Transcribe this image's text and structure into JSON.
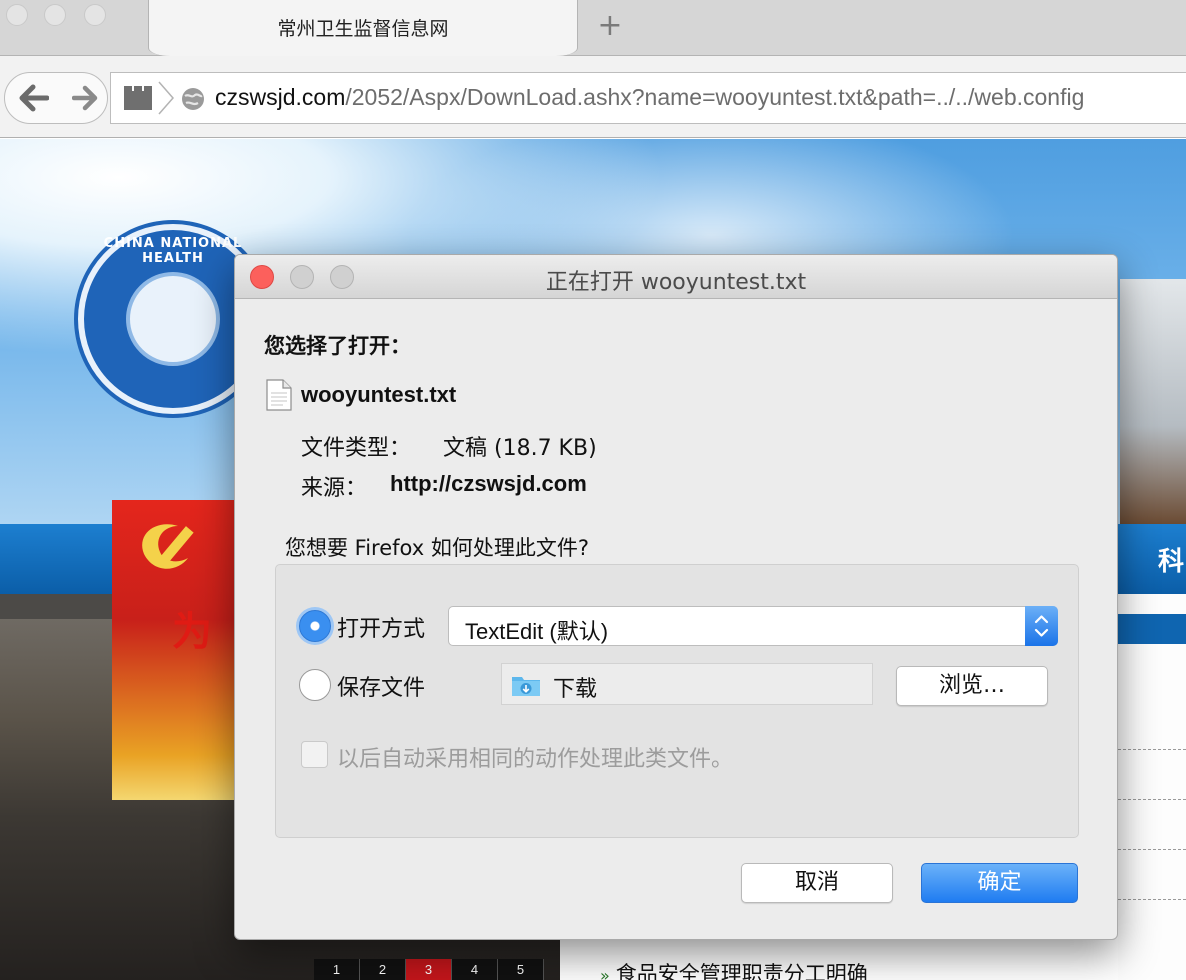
{
  "browser": {
    "tab_title": "常州卫生监督信息网",
    "new_tab_symbol": "+",
    "url_host": "czswsjd.com",
    "url_path": "/2052/Aspx/DownLoad.ashx?name=wooyuntest.txt&path=../../web.config"
  },
  "page": {
    "emblem_text": "CHINA NATIONAL HEALTH",
    "poster_char": "为",
    "nav_label": "科",
    "pager": [
      "1",
      "2",
      "3",
      "4",
      "5"
    ],
    "pager_active": "3",
    "headline": "食品安全管理职责分工明确"
  },
  "dialog": {
    "title": "正在打开 wooyuntest.txt",
    "heading": "您选择了打开：",
    "file_name": "wooyuntest.txt",
    "file_type_label": "文件类型：",
    "file_type_value": "文稿 (18.7 KB)",
    "source_label": "来源：",
    "source_value": "http://czswsjd.com",
    "question": "您想要 Firefox 如何处理此文件?",
    "open_with_label": "打开方式",
    "open_with_app": "TextEdit (默认)",
    "save_file_label": "保存文件",
    "download_folder": "下载",
    "browse_label": "浏览…",
    "auto_action_label": "以后自动采用相同的动作处理此类文件。",
    "cancel_label": "取消",
    "ok_label": "确定",
    "selected_option": "open_with",
    "accent_color": "#1f7cf1"
  }
}
